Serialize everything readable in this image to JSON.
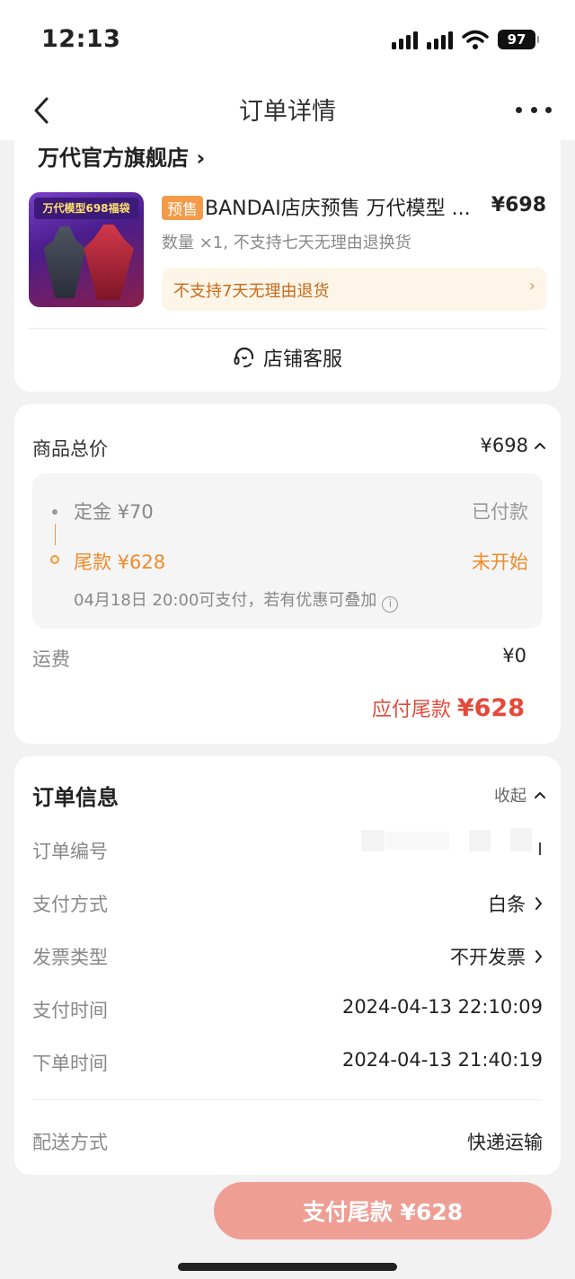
{
  "status_bar": {
    "time": "12:13",
    "battery": "97"
  },
  "nav": {
    "title": "订单详情"
  },
  "shop": {
    "name": "万代官方旗舰店 ›"
  },
  "product": {
    "tag": "预售",
    "title": "BANDAI店庆预售 万代模型 ...",
    "price": "¥698",
    "qty_note": "数量 ×1, 不支持七天无理由退换货",
    "image_banner": "万代模型698福袋",
    "refund_note": "不支持7天无理由退货",
    "refund_arrow": "›"
  },
  "service": {
    "label": "店铺客服"
  },
  "price_section": {
    "total_label": "商品总价",
    "total_value": "¥698",
    "deposit_label": "定金 ¥70",
    "deposit_status": "已付款",
    "balance_label": "尾款 ¥628",
    "balance_status": "未开始",
    "balance_note": "04月18日 20:00可支付，若有优惠可叠加",
    "shipping_label": "运费",
    "shipping_value": "¥0",
    "due_prefix": "应付尾款",
    "due_amount": "¥628"
  },
  "order_info": {
    "title": "订单信息",
    "collapse_label": "收起",
    "rows": [
      {
        "label": "订单编号",
        "value": ""
      },
      {
        "label": "支付方式",
        "value": "白条"
      },
      {
        "label": "发票类型",
        "value": "不开发票"
      },
      {
        "label": "支付时间",
        "value": "2024-04-13 22:10:09"
      },
      {
        "label": "下单时间",
        "value": "2024-04-13 21:40:19"
      },
      {
        "label": "配送方式",
        "value": "快递运输"
      }
    ]
  },
  "footer": {
    "pay_button": "支付尾款 ¥628"
  }
}
